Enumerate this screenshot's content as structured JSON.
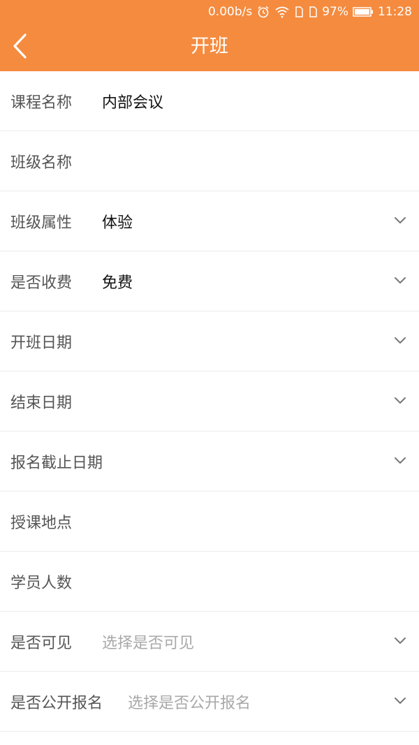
{
  "status_bar": {
    "speed": "0.00b/s",
    "battery": "97%",
    "time": "11:28",
    "icons": [
      "alarm-icon",
      "wifi-icon",
      "sim1-icon",
      "sim2-icon",
      "battery-icon"
    ]
  },
  "header": {
    "title": "开班",
    "back_icon": "chevron-left-icon",
    "bg_color": "#f58b3f"
  },
  "form": {
    "rows": [
      {
        "label": "课程名称",
        "value": "内部会议",
        "placeholder": "",
        "dropdown": false
      },
      {
        "label": "班级名称",
        "value": "",
        "placeholder": "",
        "dropdown": false
      },
      {
        "label": "班级属性",
        "value": "体验",
        "placeholder": "",
        "dropdown": true
      },
      {
        "label": "是否收费",
        "value": "免费",
        "placeholder": "",
        "dropdown": true
      },
      {
        "label": "开班日期",
        "value": "",
        "placeholder": "",
        "dropdown": true
      },
      {
        "label": "结束日期",
        "value": "",
        "placeholder": "",
        "dropdown": true
      },
      {
        "label": "报名截止日期",
        "value": "",
        "placeholder": "",
        "dropdown": true
      },
      {
        "label": "授课地点",
        "value": "",
        "placeholder": "",
        "dropdown": false
      },
      {
        "label": "学员人数",
        "value": "",
        "placeholder": "",
        "dropdown": false
      },
      {
        "label": "是否可见",
        "value": "",
        "placeholder": "选择是否可见",
        "dropdown": true
      },
      {
        "label": "是否公开报名",
        "value": "",
        "placeholder": "选择是否公开报名",
        "dropdown": true
      }
    ]
  }
}
